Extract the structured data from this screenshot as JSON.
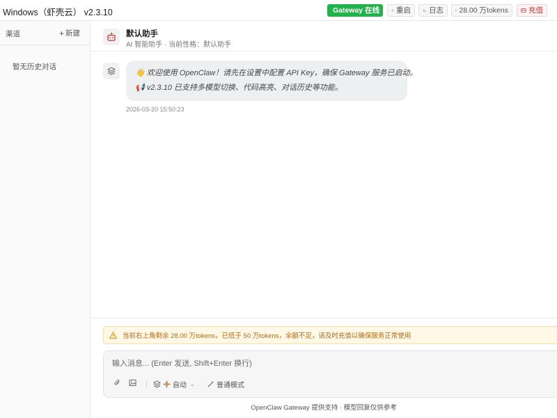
{
  "app": {
    "title": "Windows（虾壳云）  v2.3.10"
  },
  "topbar": {
    "gateway_label": "Gateway 在线",
    "restart_label": "重启",
    "logs_label": "日志",
    "tokens_label": "28.00 万tokens",
    "recharge_label": "充值"
  },
  "sidebar": {
    "title": "渠道",
    "new_label": "新建",
    "empty_text": "暂无历史对话"
  },
  "chat": {
    "bot_name": "默认助手",
    "bot_subtitle": "AI 智能助手 · 当前性格：默认助手",
    "message": {
      "line1": "👋 欢迎使用 OpenClaw！请先在设置中配置 API Key，确保 Gateway 服务已启动。",
      "line2": "📢 v2.3.10 已支持多模型切换、代码高亮、对话历史等功能。",
      "time": "2026-03-20 15:50:23"
    }
  },
  "composer": {
    "warning": "当前右上角剩余 28.00 万tokens，已低于 50 万tokens，余额不足，请及时充值以确保服务正常使用",
    "placeholder": "输入消息... (Enter 发送, Shift+Enter 换行)",
    "model_label": "自动",
    "mode_label": "普通模式",
    "footer": "OpenClaw Gateway 提供支持 · 模型回复仅供参考"
  },
  "colors": {
    "gateway_green": "#22b24c",
    "recharge_red": "#d93030",
    "warn_text": "#b56a10",
    "warn_bg": "#fff8e6"
  }
}
